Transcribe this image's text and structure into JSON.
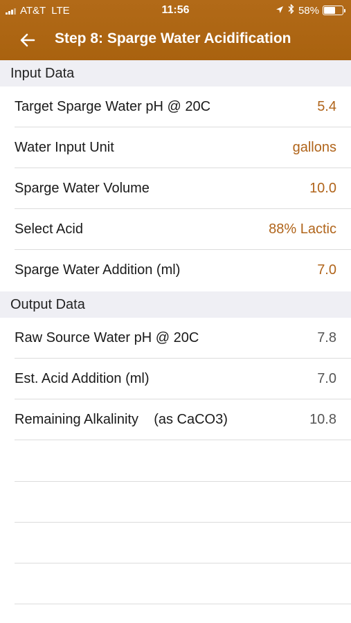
{
  "status": {
    "carrier": "AT&T",
    "network": "LTE",
    "time": "11:56",
    "battery": "58%"
  },
  "nav": {
    "title": "Step 8: Sparge Water Acidification"
  },
  "input_section": {
    "title": "Input Data",
    "rows": [
      {
        "label": "Target Sparge Water pH @ 20C",
        "value": "5.4"
      },
      {
        "label": "Water Input Unit",
        "value": "gallons"
      },
      {
        "label": "Sparge Water Volume",
        "value": "10.0"
      },
      {
        "label": "Select Acid",
        "value": "88% Lactic"
      },
      {
        "label": "Sparge Water Addition (ml)",
        "value": "7.0"
      }
    ]
  },
  "output_section": {
    "title": "Output Data",
    "rows": [
      {
        "label": "Raw Source Water pH @ 20C",
        "value": "7.8"
      },
      {
        "label": "Est. Acid Addition (ml)",
        "value": "7.0"
      },
      {
        "label": "Remaining Alkalinity    (as CaCO3)",
        "value": "10.8"
      }
    ]
  },
  "colors": {
    "header": "#a9620f",
    "input_value": "#b0641a",
    "section_bg": "#efeff4"
  }
}
